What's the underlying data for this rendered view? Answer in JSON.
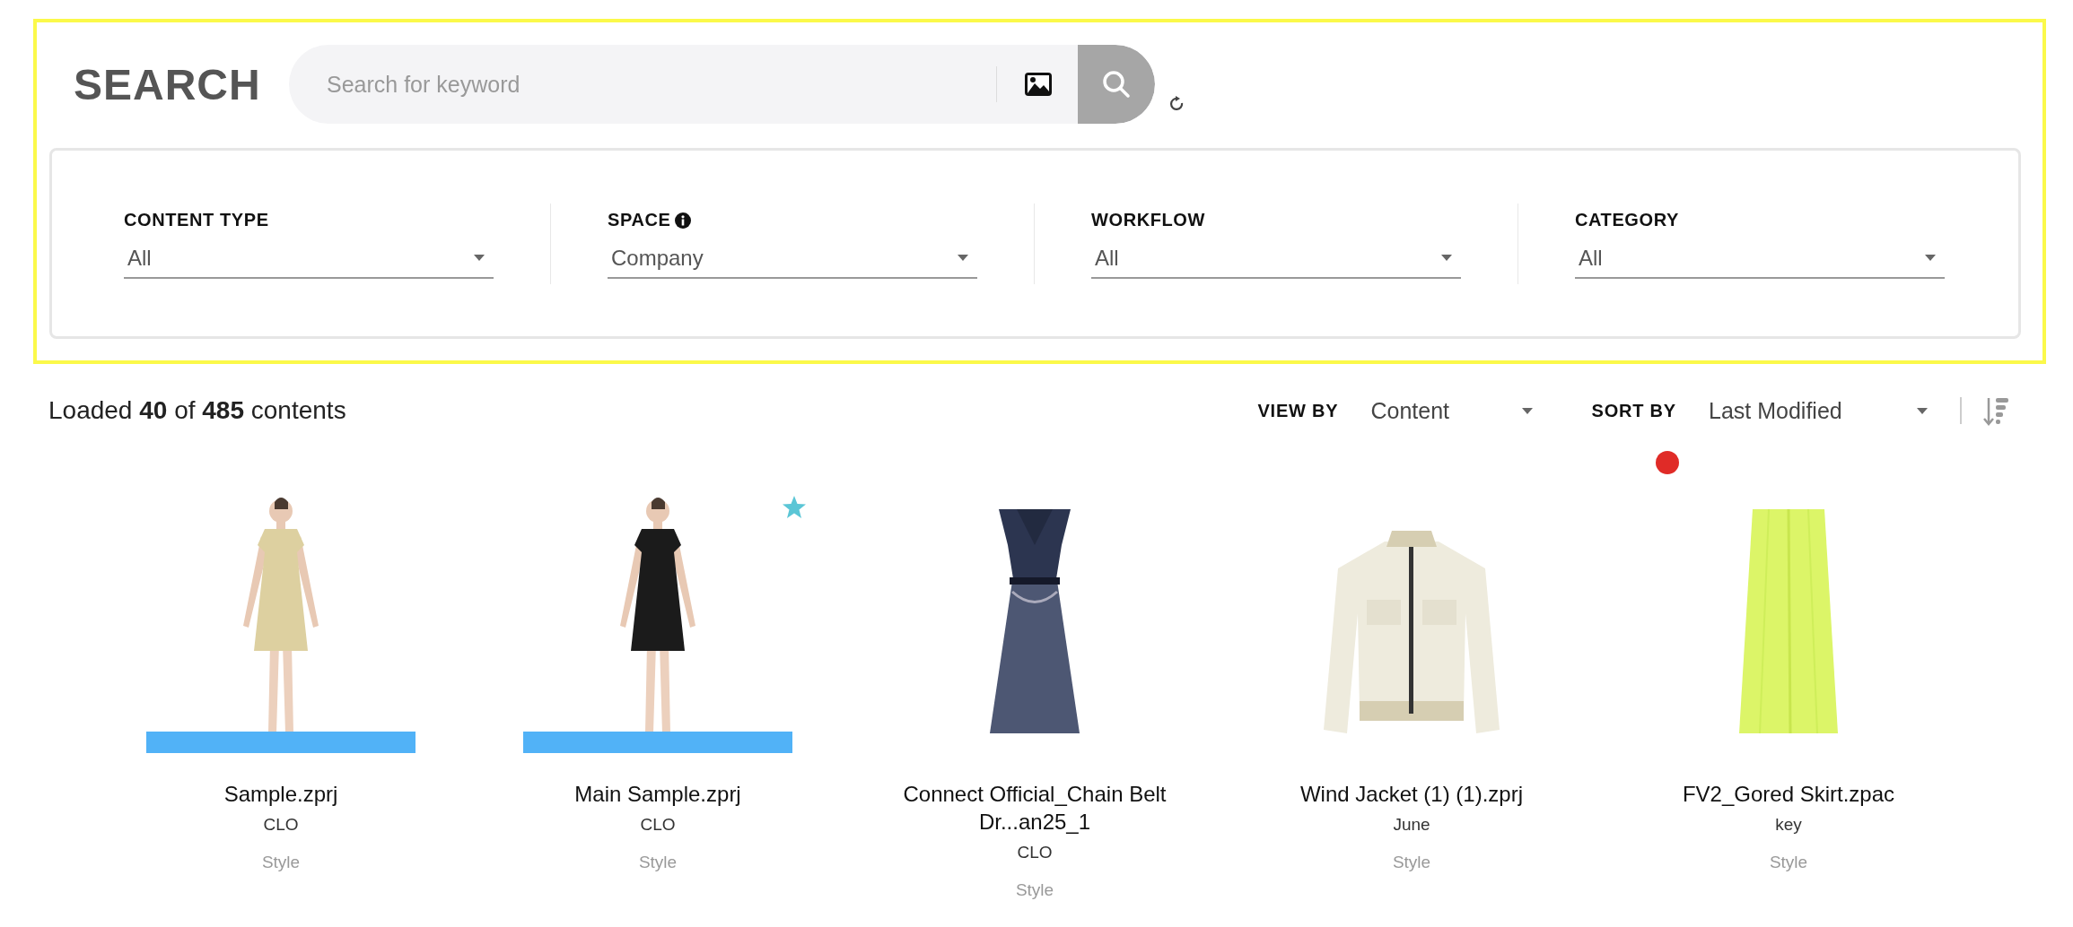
{
  "search": {
    "title": "SEARCH",
    "placeholder": "Search for keyword"
  },
  "filters": [
    {
      "label": "CONTENT TYPE",
      "info": false,
      "value": "All"
    },
    {
      "label": "SPACE",
      "info": true,
      "value": "Company"
    },
    {
      "label": "WORKFLOW",
      "info": false,
      "value": "All"
    },
    {
      "label": "CATEGORY",
      "info": false,
      "value": "All"
    }
  ],
  "results": {
    "summary": "Loaded **40** of **485** contents",
    "view_by": {
      "label": "VIEW BY",
      "value": "Content"
    },
    "sort_by": {
      "label": "SORT BY",
      "value": "Last Modified"
    }
  },
  "cards": [
    {
      "kind": "picture",
      "title": "Sample.zprj",
      "owner": "CLO",
      "type": "Style",
      "base_bar": true,
      "favorite": false,
      "new": false
    },
    {
      "kind": "picture",
      "title": "Main Sample.zprj",
      "owner": "CLO",
      "type": "Style",
      "base_bar": true,
      "favorite": true,
      "new": false
    },
    {
      "kind": "picture",
      "title": "Connect Official_Chain Belt Dr...an25_1",
      "owner": "CLO",
      "type": "Style",
      "base_bar": false,
      "favorite": false,
      "new": false
    },
    {
      "kind": "picture",
      "title": "Wind Jacket (1) (1).zprj",
      "owner": "June",
      "type": "Style",
      "base_bar": false,
      "favorite": false,
      "new": false
    },
    {
      "kind": "picture",
      "title": "FV2_Gored Skirt.zpac",
      "owner": "key",
      "type": "Style",
      "base_bar": false,
      "favorite": false,
      "new": true
    }
  ]
}
